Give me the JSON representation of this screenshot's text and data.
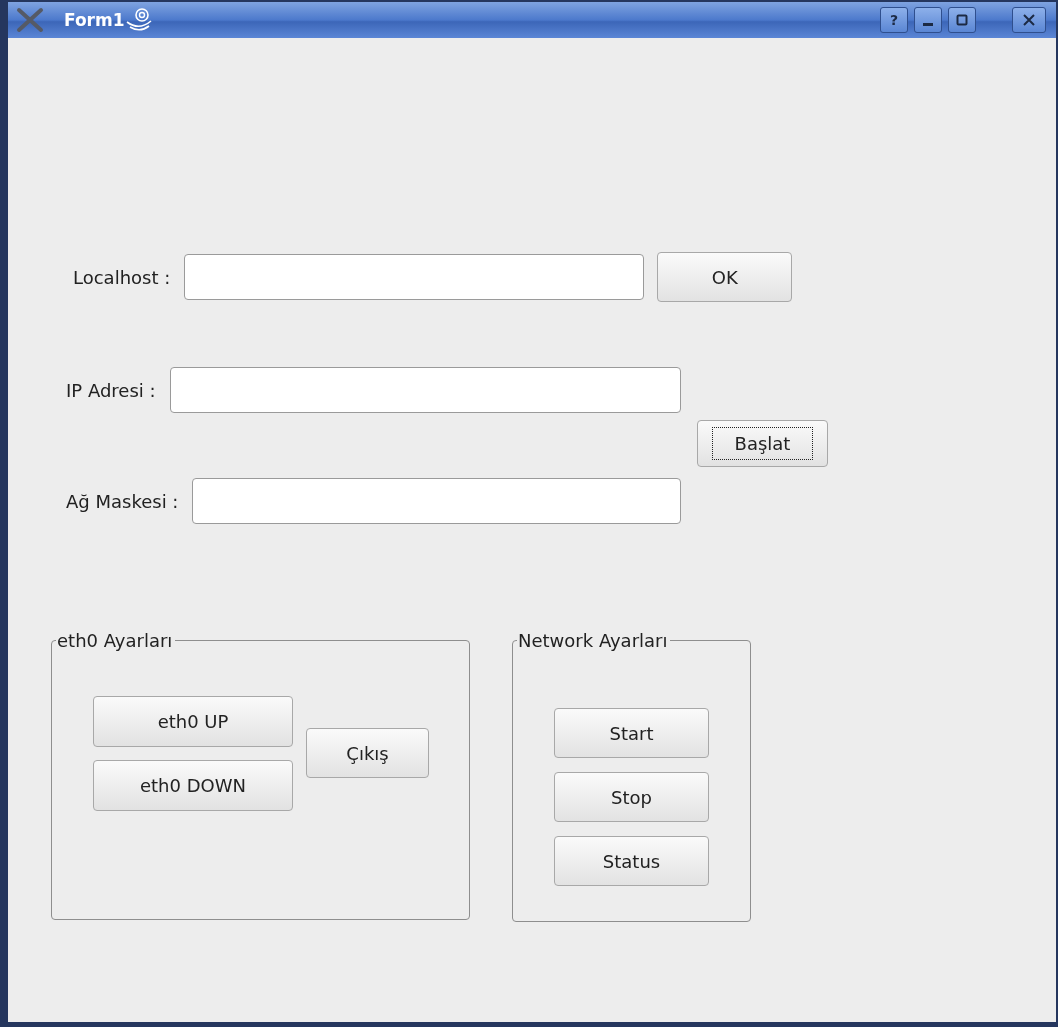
{
  "window": {
    "title": "Form1"
  },
  "title_buttons": [
    {
      "kind": "help",
      "label": "?"
    },
    {
      "kind": "minimize"
    },
    {
      "kind": "maximize"
    },
    {
      "kind": "close"
    }
  ],
  "localhost": {
    "label": "Localhost :",
    "button": {
      "label": "OK",
      "focused": false
    }
  },
  "ip_address": {
    "label": "IP Adresi :"
  },
  "start_button": {
    "label": "Başlat",
    "focused": true
  },
  "netmask": {
    "label": "Ağ Maskesi :"
  },
  "eth0_group": {
    "title": "eth0 Ayarları",
    "buttons": [
      {
        "label": "eth0 UP",
        "focused": false
      },
      {
        "label": "eth0 DOWN",
        "focused": false
      }
    ],
    "exit_button": {
      "label": "Çıkış",
      "focused": false
    }
  },
  "network_group": {
    "title": "Network Ayarları",
    "buttons": [
      {
        "label": "Start",
        "focused": false
      },
      {
        "label": "Stop",
        "focused": false
      },
      {
        "label": "Status",
        "focused": false
      }
    ]
  }
}
